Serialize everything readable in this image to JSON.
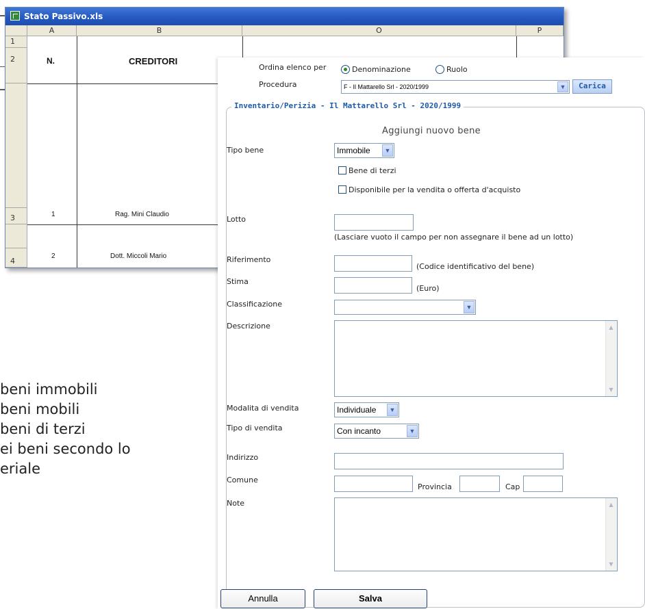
{
  "excel": {
    "title": "Stato Passivo.xls",
    "columns": [
      "A",
      "B",
      "O",
      "P"
    ],
    "rows": [
      "1",
      "2",
      "3",
      "4"
    ],
    "header_n": "N.",
    "header_creditori": "CREDITORI",
    "data_rows": [
      {
        "n": "1",
        "creditore": "Rag. Mini Claudio"
      },
      {
        "n": "2",
        "creditore": "Dott. Miccoli Mario"
      }
    ]
  },
  "slide_text": [
    "beni immobili",
    "beni mobili",
    "beni di terzi",
    "ei beni secondo lo",
    "eriale"
  ],
  "form": {
    "ordina_label": "Ordina elenco per",
    "ordina_options": [
      {
        "label": "Denominazione",
        "selected": true
      },
      {
        "label": "Ruolo",
        "selected": false
      }
    ],
    "procedura_label": "Procedura",
    "procedura_value": "F - Il Mattarello Srl - 2020/1999",
    "carica_button": "Carica",
    "legend": "Inventario/Perizia - Il Mattarello Srl - 2020/1999",
    "subtitle": "Aggiungi nuovo bene",
    "tipo_bene_label": "Tipo bene",
    "tipo_bene_value": "Immobile",
    "bene_terzi_label": "Bene di terzi",
    "disponibile_label": "Disponibile per la vendita o offerta d'acquisto",
    "lotto_label": "Lotto",
    "lotto_hint": "(Lasciare vuoto il campo per non assegnare il bene ad un lotto)",
    "riferimento_label": "Riferimento",
    "riferimento_hint": "(Codice identificativo del bene)",
    "stima_label": "Stima",
    "stima_hint": "(Euro)",
    "classificazione_label": "Classificazione",
    "classificazione_value": "",
    "descrizione_label": "Descrizione",
    "modalita_label": "Modalita di vendita",
    "modalita_value": "Individuale",
    "tipo_vendita_label": "Tipo di vendita",
    "tipo_vendita_value": "Con incanto",
    "indirizzo_label": "Indirizzo",
    "comune_label": "Comune",
    "provincia_label": "Provincia",
    "cap_label": "Cap",
    "note_label": "Note",
    "annulla_button": "Annulla",
    "salva_button": "Salva"
  },
  "colors": {
    "accent_blue": "#1e5aa8",
    "excel_title": "#2457bf",
    "radio_dot": "#2b8a2b"
  }
}
